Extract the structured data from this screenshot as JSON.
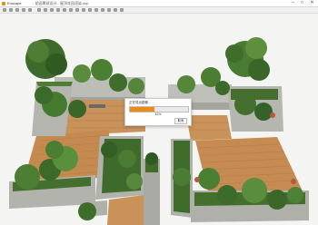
{
  "window": {
    "app_title": "Enscape",
    "file_title": "- 花园景观设计 - 屋顶花园渲染.skp",
    "controls": [
      "–",
      "□",
      "✕"
    ]
  },
  "dialog": {
    "message": "正在导出图像...",
    "progress": 0.42,
    "percent_text": "42%",
    "cancel_label": "取消"
  },
  "colors": {
    "accent": "#ef8a17"
  }
}
